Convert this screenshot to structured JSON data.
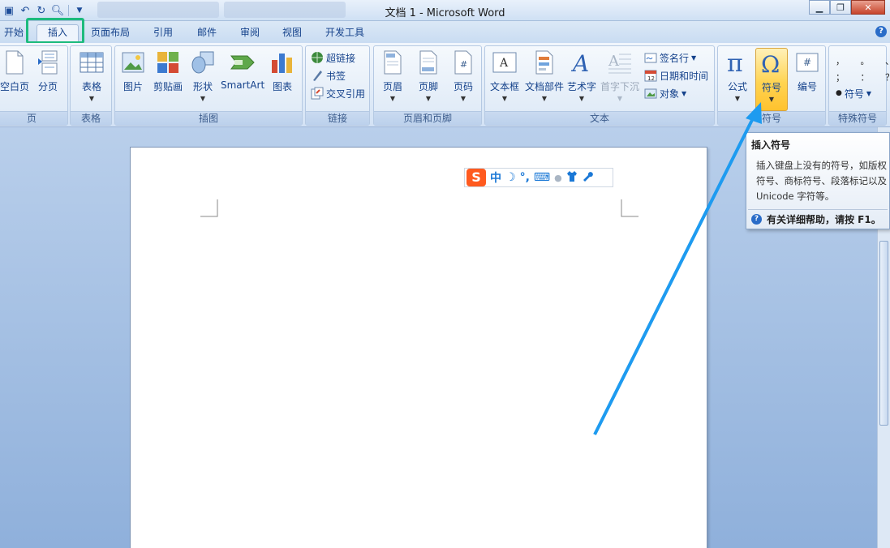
{
  "window": {
    "title": "文档 1 - Microsoft Word",
    "minimize": "▁",
    "restore": "❐",
    "close": "✕"
  },
  "tabs": [
    {
      "label": "开始"
    },
    {
      "label": "插入"
    },
    {
      "label": "页面布局"
    },
    {
      "label": "引用"
    },
    {
      "label": "邮件"
    },
    {
      "label": "审阅"
    },
    {
      "label": "视图"
    },
    {
      "label": "开发工具"
    }
  ],
  "active_tab": "插入",
  "ribbon": {
    "pages": {
      "label": "页",
      "blank_page": "空白页",
      "page_break": "分页"
    },
    "tables": {
      "label": "表格",
      "table": "表格"
    },
    "illustrations": {
      "label": "插图",
      "picture": "图片",
      "clipart": "剪贴画",
      "shapes": "形状",
      "smartart": "SmartArt",
      "chart": "图表"
    },
    "links": {
      "label": "链接",
      "hyperlink": "超链接",
      "bookmark": "书签",
      "cross_ref": "交叉引用"
    },
    "header_footer": {
      "label": "页眉和页脚",
      "header": "页眉",
      "footer": "页脚",
      "page_number": "页码"
    },
    "text": {
      "label": "文本",
      "textbox": "文本框",
      "quick_parts": "文档部件",
      "wordart": "艺术字",
      "dropcap": "首字下沉",
      "signature": "签名行",
      "datetime": "日期和时间",
      "object": "对象"
    },
    "symbols": {
      "label": "符号",
      "equation": "公式",
      "symbol": "符号",
      "number": "编号"
    },
    "special": {
      "label": "特殊符号",
      "symbol": "符号",
      "marks_row1": "， 。 、",
      "marks_row2": "； ： ？"
    }
  },
  "tooltip": {
    "title": "插入符号",
    "body": "插入键盘上没有的符号，如版权符号、商标符号、段落标记以及 Unicode 字符等。",
    "help": "有关详细帮助，请按 F1。"
  },
  "ime": {
    "logo": "S",
    "mode": "中",
    "moon": "☽",
    "punct": "°,",
    "keyboard": "⌨",
    "user": "●",
    "shirt": "👕",
    "wrench": "🔧"
  },
  "colors": {
    "highlight_box": "#1dbb7d",
    "arrow": "#1e9bf0",
    "active_button": "#ffd452"
  }
}
